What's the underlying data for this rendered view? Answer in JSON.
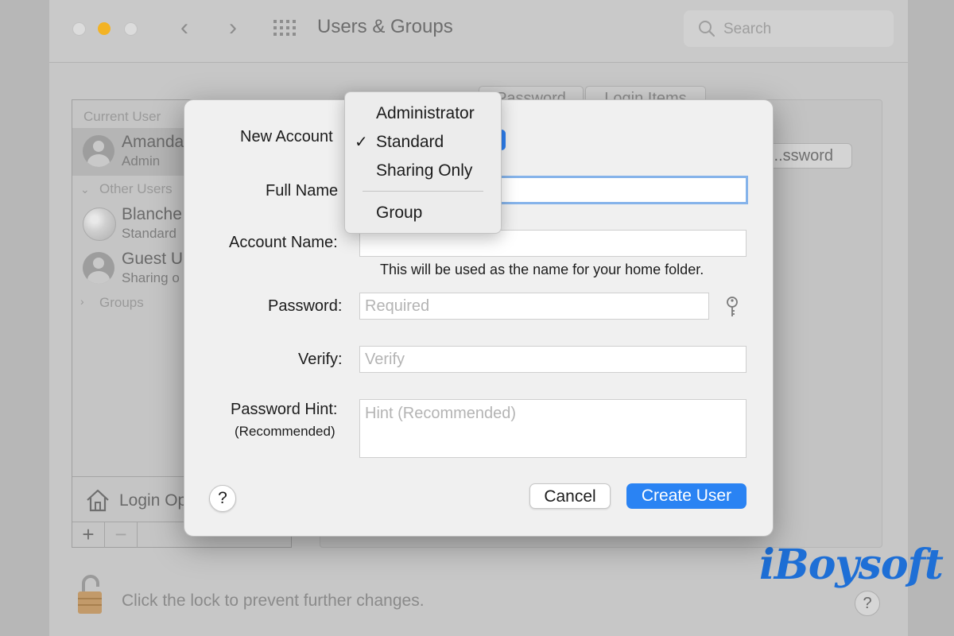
{
  "window": {
    "title": "Users & Groups",
    "nav_back": "‹",
    "nav_forward": "›",
    "search_placeholder": "Search"
  },
  "sidebar": {
    "current_user_heading": "Current User",
    "current_user": {
      "name": "Amanda",
      "role": "Admin"
    },
    "other_users_heading": "Other Users",
    "other_users": [
      {
        "name": "Blanche",
        "role": "Standard"
      },
      {
        "name": "Guest U",
        "role": "Sharing o"
      }
    ],
    "groups_heading": "Groups",
    "login_options": "Login Op",
    "add": "+",
    "remove": "−"
  },
  "content": {
    "tabs": [
      "Password",
      "Login Items"
    ],
    "change_password_button": "ssword..."
  },
  "footer": {
    "lock_text": "Click the lock to prevent further changes.",
    "help": "?"
  },
  "watermark": "iBoysoft",
  "dialog": {
    "new_account_label": "New Account",
    "full_name_label": "Full Name",
    "full_name_value": "",
    "account_name_label": "Account Name:",
    "account_name_value": "",
    "account_name_help": "This will be used as the name for your home folder.",
    "password_label": "Password:",
    "password_placeholder": "Required",
    "verify_label": "Verify:",
    "verify_placeholder": "Verify",
    "hint_label": "Password Hint:",
    "hint_sublabel": "(Recommended)",
    "hint_placeholder": "Hint (Recommended)",
    "help": "?",
    "cancel": "Cancel",
    "create_user": "Create User"
  },
  "account_type_menu": {
    "items": [
      "Administrator",
      "Standard",
      "Sharing Only",
      "Group"
    ],
    "selected": "Standard",
    "checkmark": "✓"
  },
  "colors": {
    "accent": "#2a83f3",
    "minimize_yellow": "#f3b324",
    "watermark_blue": "#1e6fd6"
  }
}
